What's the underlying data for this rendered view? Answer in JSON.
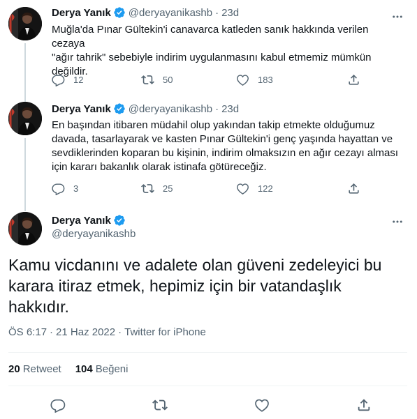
{
  "tweets": [
    {
      "name": "Derya Yanık",
      "handle": "@deryayanikashb",
      "dot": "·",
      "time": "23d",
      "text_lines": [
        "Muğla'da Pınar Gültekin'i canavarca katleden sanık hakkında verilen cezaya",
        "\"ağır tahrik\" sebebiyle indirim uygulanmasını kabul etmemiz mümkün",
        "değildir."
      ],
      "replies": "12",
      "retweets": "50",
      "likes": "183"
    },
    {
      "name": "Derya Yanık",
      "handle": "@deryayanikashb",
      "dot": "·",
      "time": "23d",
      "text_lines": [
        "En başından itibaren müdahil olup yakından takip etmekte olduğumuz",
        "davada, tasarlayarak ve kasten Pınar Gültekin'i genç yaşında hayattan ve",
        "sevdiklerinden koparan bu kişinin, indirim olmaksızın en ağır cezayı alması",
        "için kararı bakanlık olarak istinafa götüreceğiz."
      ],
      "replies": "3",
      "retweets": "25",
      "likes": "122"
    }
  ],
  "main": {
    "name": "Derya Yanık",
    "handle": "@deryayanikashb",
    "text_lines": [
      "Kamu vicdanını ve adalete olan güveni zedeleyici bu",
      "karara itiraz etmek, hepimiz için bir vatandaşlık",
      "hakkıdır."
    ],
    "time": "ÖS 6:17",
    "dot": "·",
    "date": "21 Haz 2022",
    "source": "Twitter for iPhone",
    "retweet_count": "20",
    "retweet_label": "Retweet",
    "like_count": "104",
    "like_label": "Beğeni"
  },
  "colors": {
    "accent": "#1d9bf0",
    "secondary": "#536471",
    "text": "#0f1419"
  },
  "icons": [
    "verified-badge-icon",
    "more-icon",
    "reply-icon",
    "retweet-icon",
    "like-icon",
    "share-icon"
  ]
}
